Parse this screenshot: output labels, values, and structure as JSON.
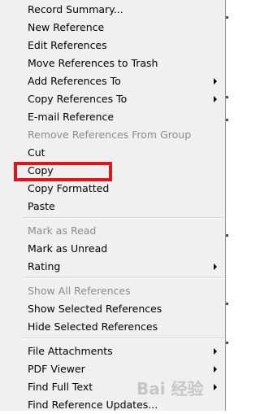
{
  "menu": {
    "items": [
      {
        "label": "Record Summary...",
        "enabled": true,
        "submenu": false
      },
      {
        "label": "New Reference",
        "enabled": true,
        "submenu": false
      },
      {
        "label": "Edit References",
        "enabled": true,
        "submenu": false
      },
      {
        "label": "Move References to Trash",
        "enabled": true,
        "submenu": false
      },
      {
        "label": "Add References To",
        "enabled": true,
        "submenu": true
      },
      {
        "label": "Copy References To",
        "enabled": true,
        "submenu": true
      },
      {
        "label": "E-mail Reference",
        "enabled": true,
        "submenu": false
      },
      {
        "label": "Remove References From Group",
        "enabled": false,
        "submenu": false
      },
      {
        "label": "Cut",
        "enabled": true,
        "submenu": false
      },
      {
        "label": "Copy",
        "enabled": true,
        "submenu": false,
        "highlighted": true
      },
      {
        "label": "Copy Formatted",
        "enabled": true,
        "submenu": false
      },
      {
        "label": "Paste",
        "enabled": true,
        "submenu": false
      },
      {
        "label": "Mark as Read",
        "enabled": false,
        "submenu": false
      },
      {
        "label": "Mark as Unread",
        "enabled": true,
        "submenu": false
      },
      {
        "label": "Rating",
        "enabled": true,
        "submenu": true
      },
      {
        "label": "Show All References",
        "enabled": false,
        "submenu": false
      },
      {
        "label": "Show Selected References",
        "enabled": true,
        "submenu": false
      },
      {
        "label": "Hide Selected References",
        "enabled": true,
        "submenu": false
      },
      {
        "label": "File Attachments",
        "enabled": true,
        "submenu": true
      },
      {
        "label": "PDF Viewer",
        "enabled": true,
        "submenu": true
      },
      {
        "label": "Find Full Text",
        "enabled": true,
        "submenu": true
      },
      {
        "label": "Find Reference Updates...",
        "enabled": true,
        "submenu": false
      }
    ]
  },
  "annotation": {
    "highlight_color": "#e0141d"
  },
  "watermark": {
    "text": "Bai 经验"
  }
}
